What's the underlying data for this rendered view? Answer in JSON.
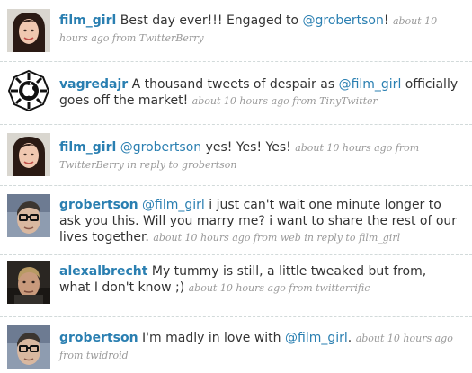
{
  "tweets": [
    {
      "user": "film_girl",
      "avatar": "woman-dark-hair-avatar",
      "text_pre": "Best day ever!!! Engaged to ",
      "mention": "@grobertson",
      "text_post": "!",
      "meta": "about 10 hours ago from TwitterBerry"
    },
    {
      "user": "vagredajr",
      "avatar": "dharma-apple-logo-avatar",
      "text_pre": "A thousand tweets of despair as ",
      "mention": "@film_girl",
      "text_post": " officially goes off the market!",
      "meta": "about 10 hours ago from TinyTwitter"
    },
    {
      "user": "film_girl",
      "avatar": "woman-dark-hair-avatar",
      "text_pre": "",
      "mention": "@grobertson",
      "text_post": " yes! Yes! Yes!",
      "meta": "about 10 hours ago from TwitterBerry in reply to grobertson"
    },
    {
      "user": "grobertson",
      "avatar": "man-glasses-avatar",
      "text_pre": "",
      "mention": "@film_girl",
      "text_post": " i just can't wait one minute longer to ask you this. Will you marry me? i want to share the rest of our lives together.",
      "meta": "about 10 hours ago from web in reply to film_girl"
    },
    {
      "user": "alexalbrecht",
      "avatar": "man-blond-avatar",
      "text_pre": "My tummy is still, a little tweaked but from, what I don't know ;)",
      "mention": "",
      "text_post": "",
      "meta": "about 10 hours ago from twitterrific"
    },
    {
      "user": "grobertson",
      "avatar": "man-glasses-avatar",
      "text_pre": "I'm madly in love with ",
      "mention": "@film_girl",
      "text_post": ".",
      "meta": "about 10 hours ago from twidroid"
    }
  ]
}
